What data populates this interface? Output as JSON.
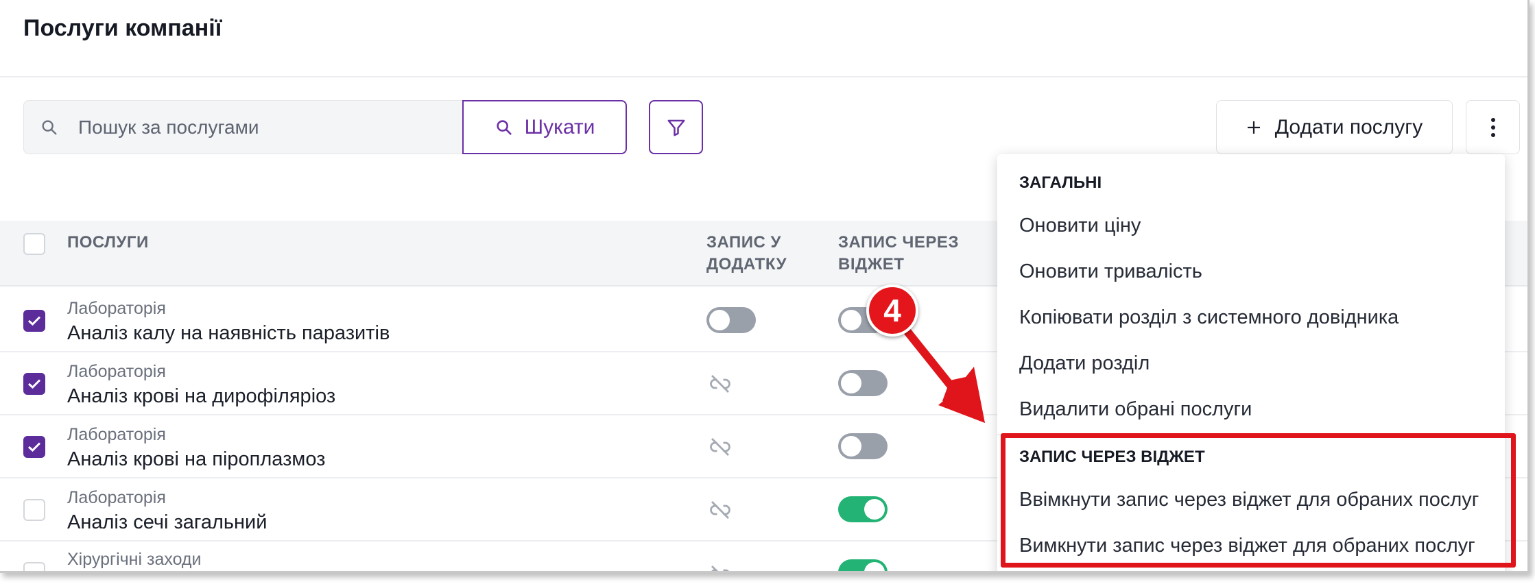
{
  "page": {
    "title": "Послуги компанії"
  },
  "search": {
    "placeholder": "Пошук за послугами",
    "button_label": "Шукати"
  },
  "actions": {
    "add_label": "Додати послугу"
  },
  "table": {
    "columns": {
      "services": "ПОСЛУГИ",
      "app_booking": [
        "ЗАПИС У",
        "ДОДАТКУ"
      ],
      "widget_booking": [
        "ЗАПИС ЧЕРЕЗ",
        "ВІДЖЕТ"
      ]
    },
    "rows": [
      {
        "category": "Лабораторія",
        "name": "Аналіз калу на наявність паразитів",
        "checked": true,
        "app": "off",
        "widget": "off"
      },
      {
        "category": "Лабораторія",
        "name": "Аналіз крові на дирофіляріоз",
        "checked": true,
        "app": "unlinked",
        "widget": "off"
      },
      {
        "category": "Лабораторія",
        "name": "Аналіз крові на піроплазмоз",
        "checked": true,
        "app": "unlinked",
        "widget": "off"
      },
      {
        "category": "Лабораторія",
        "name": "Аналіз сечі загальний",
        "checked": false,
        "app": "unlinked",
        "widget": "on"
      },
      {
        "category": "Хірургічні заходи",
        "name": "",
        "checked": false,
        "app": "unlinked",
        "widget": "on"
      }
    ]
  },
  "menu": {
    "general_title": "ЗАГАЛЬНІ",
    "general_items": [
      "Оновити ціну",
      "Оновити тривалість",
      "Копіювати розділ з системного довідника",
      "Додати розділ",
      "Видалити обрані послуги"
    ],
    "widget_title": "ЗАПИС ЧЕРЕЗ ВІДЖЕТ",
    "widget_items": [
      "Ввімкнути запис через віджет для обраних послуг",
      "Вимкнути запис через віджет для обраних послуг"
    ]
  },
  "annotation": {
    "step": "4"
  },
  "colors": {
    "accent": "#6b2fa6",
    "toggle_on": "#23b374",
    "toggle_off": "#9aa0aa",
    "annotation": "#e0141b"
  }
}
